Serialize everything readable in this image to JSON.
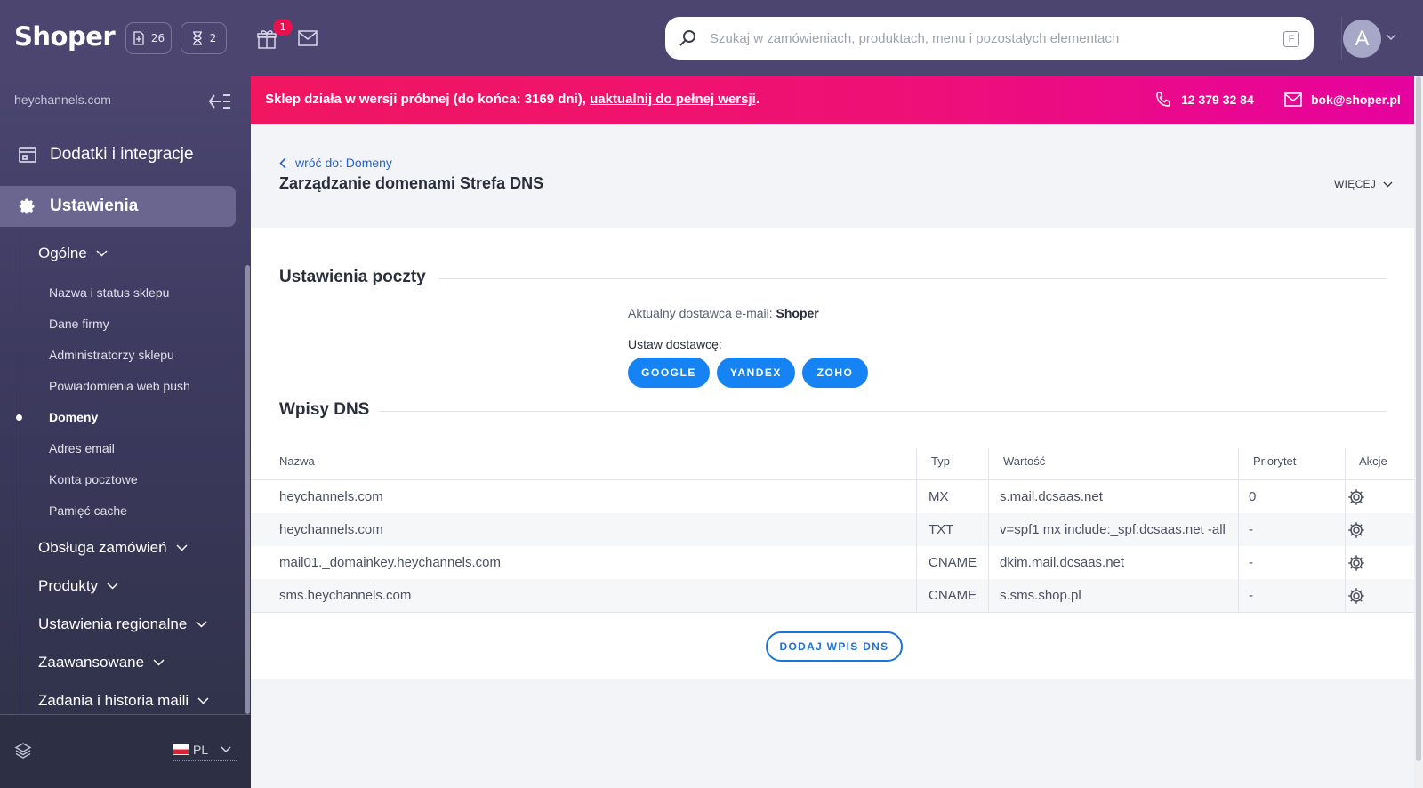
{
  "app": {
    "logo": "Shoper",
    "orders_count": "26",
    "pending_count": "2",
    "gift_badge": "1"
  },
  "search": {
    "placeholder": "Szukaj w zamówieniach, produktach, menu i pozostałych elementach",
    "shortcut": "F"
  },
  "user": {
    "avatar_letter": "A"
  },
  "promo": {
    "message": "Sklep działa w wersji próbnej (do końca: 3169 dni), ",
    "link": "uaktualnij do pełnej wersji",
    "suffix": ".",
    "phone": "12 379 32 84",
    "email": "bok@shoper.pl"
  },
  "sidebar": {
    "domain": "heychannels.com",
    "main_items": [
      {
        "label": "Dodatki i integracje",
        "icon": "window-icon"
      },
      {
        "label": "Ustawienia",
        "icon": "gear-icon"
      }
    ],
    "groups": [
      {
        "label": "Ogólne"
      },
      {
        "label": "Obsługa zamówień"
      },
      {
        "label": "Produkty"
      },
      {
        "label": "Ustawienia regionalne"
      },
      {
        "label": "Zaawansowane"
      },
      {
        "label": "Zadania i historia maili"
      }
    ],
    "sub_items": [
      {
        "label": "Nazwa i status sklepu"
      },
      {
        "label": "Dane firmy"
      },
      {
        "label": "Administratorzy sklepu"
      },
      {
        "label": "Powiadomienia web push"
      },
      {
        "label": "Domeny"
      },
      {
        "label": "Adres email"
      },
      {
        "label": "Konta pocztowe"
      },
      {
        "label": "Pamięć cache"
      }
    ],
    "language": "PL"
  },
  "page": {
    "back_link": "wróć do: Domeny",
    "title": "Zarządzanie domenami Strefa DNS",
    "more": "WIĘCEJ"
  },
  "mail_settings": {
    "title": "Ustawienia poczty",
    "current_provider_label": "Aktualny dostawca e-mail:",
    "current_provider": "Shoper",
    "set_provider_label": "Ustaw dostawcę:",
    "providers": [
      "GOOGLE",
      "YANDEX",
      "ZOHO"
    ]
  },
  "dns": {
    "title": "Wpisy DNS",
    "columns": [
      "Nazwa",
      "Typ",
      "Wartość",
      "Priorytet",
      "Akcje"
    ],
    "rows": [
      {
        "name": "heychannels.com",
        "type": "MX",
        "value": "s.mail.dcsaas.net",
        "priority": "0"
      },
      {
        "name": "heychannels.com",
        "type": "TXT",
        "value": "v=spf1 mx include:_spf.dcsaas.net -all",
        "priority": "-"
      },
      {
        "name": "mail01._domainkey.heychannels.com",
        "type": "CNAME",
        "value": "dkim.mail.dcsaas.net",
        "priority": "-"
      },
      {
        "name": "sms.heychannels.com",
        "type": "CNAME",
        "value": "s.sms.shop.pl",
        "priority": "-"
      }
    ],
    "add_button": "DODAJ WPIS DNS"
  },
  "colors": {
    "topbar": "#4b4570",
    "promo": "#f01660",
    "accent_blue": "#1683f5"
  }
}
